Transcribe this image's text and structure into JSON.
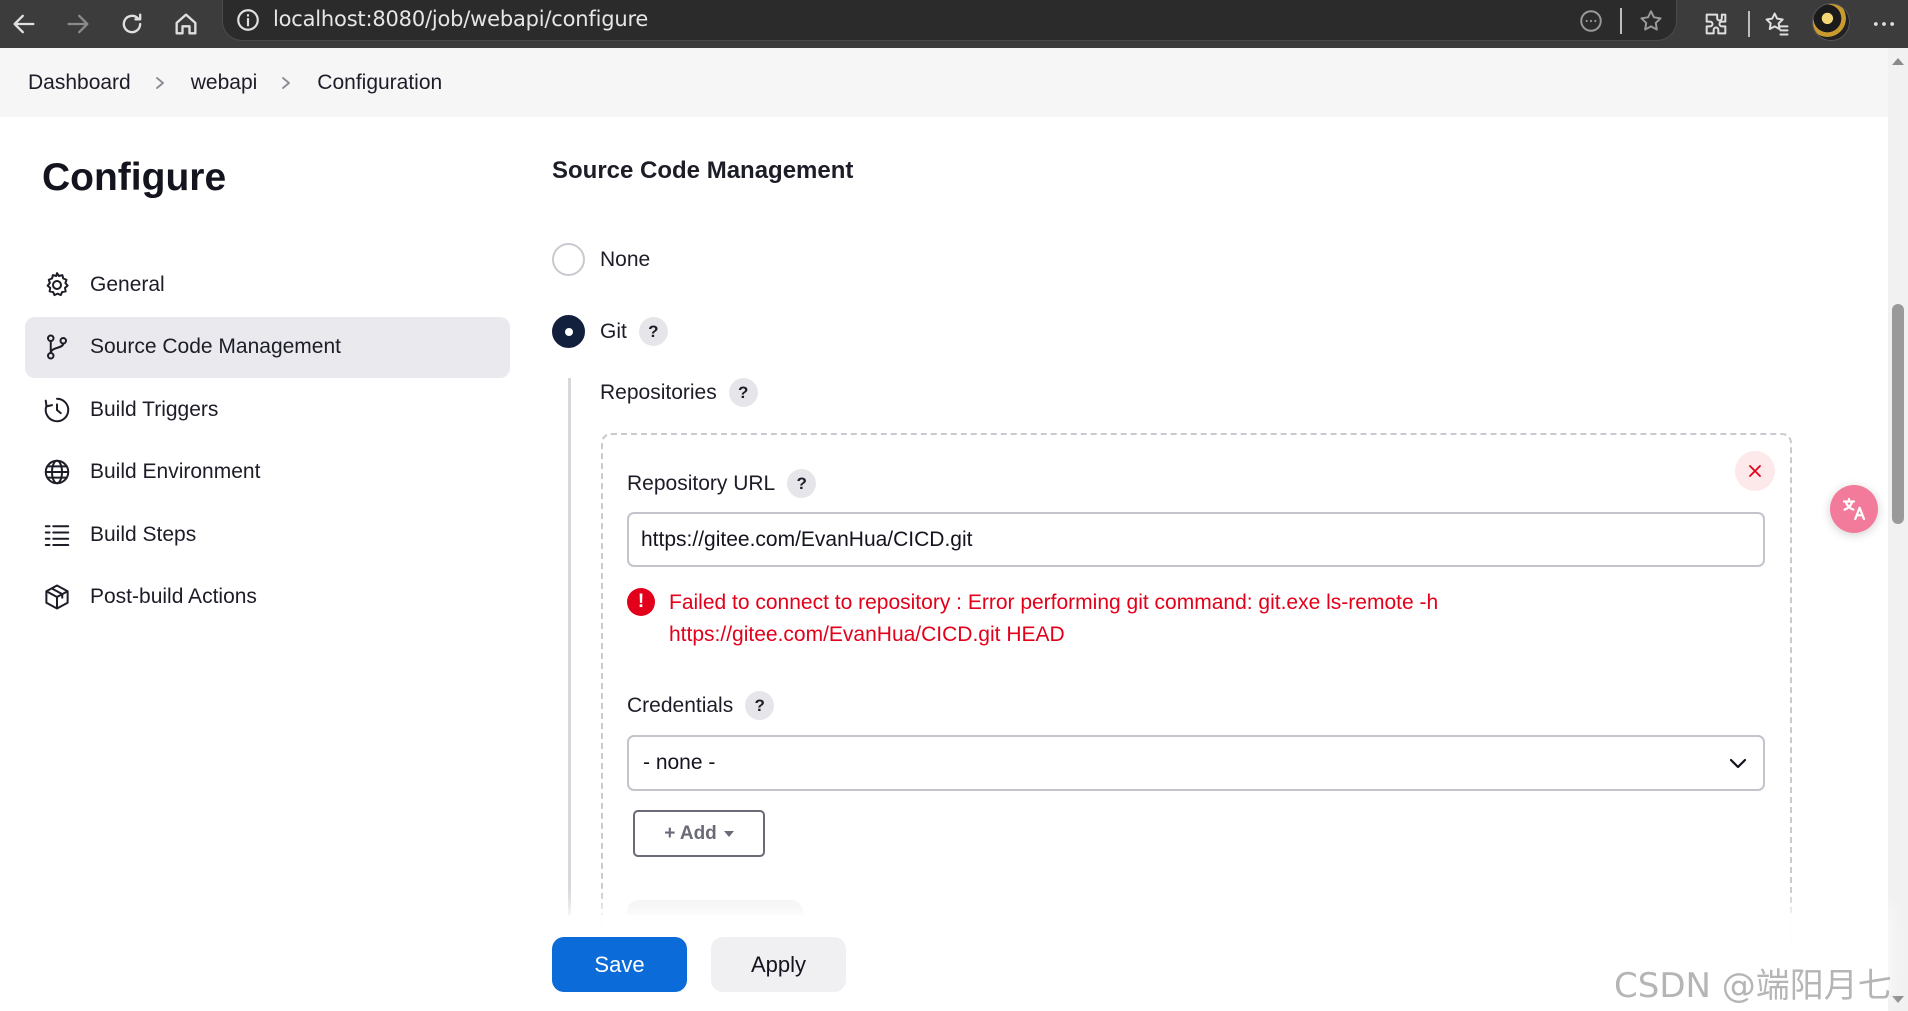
{
  "browser": {
    "url": "localhost:8080/job/webapi/configure",
    "icons": [
      "back-arrow-icon",
      "forward-arrow-icon",
      "refresh-icon",
      "home-icon",
      "info-icon",
      "reader-mode-icon",
      "favorite-star-icon",
      "extensions-icon",
      "favorites-icon",
      "more-icon"
    ]
  },
  "breadcrumb": {
    "items": [
      "Dashboard",
      "webapi",
      "Configuration"
    ]
  },
  "sidebar": {
    "title": "Configure",
    "items": [
      {
        "label": "General",
        "icon": "gear-icon"
      },
      {
        "label": "Source Code Management",
        "icon": "branch-icon",
        "active": true
      },
      {
        "label": "Build Triggers",
        "icon": "clock-icon"
      },
      {
        "label": "Build Environment",
        "icon": "globe-icon"
      },
      {
        "label": "Build Steps",
        "icon": "list-icon"
      },
      {
        "label": "Post-build Actions",
        "icon": "package-icon"
      }
    ]
  },
  "scm": {
    "title": "Source Code Management",
    "options": [
      {
        "label": "None",
        "checked": false
      },
      {
        "label": "Git",
        "checked": true
      }
    ],
    "repositories_label": "Repositories",
    "repo_url_label": "Repository URL",
    "repo_url_value": "https://gitee.com/EvanHua/CICD.git",
    "error_icon": "!",
    "error_line1": "Failed to connect to repository : Error performing git command: git.exe ls-remote -h",
    "error_line2": "https://gitee.com/EvanHua/CICD.git HEAD",
    "credentials_label": "Credentials",
    "credentials_value": "- none -",
    "add_label": "+ Add",
    "help_glyph": "?"
  },
  "actions": {
    "save": "Save",
    "apply": "Apply"
  },
  "watermark": "CSDN @端阳月七",
  "colors": {
    "primary": "#0b6bd8",
    "error": "#e2001a",
    "active_nav": "#e9e9ee",
    "radio_checked": "#13203d"
  }
}
